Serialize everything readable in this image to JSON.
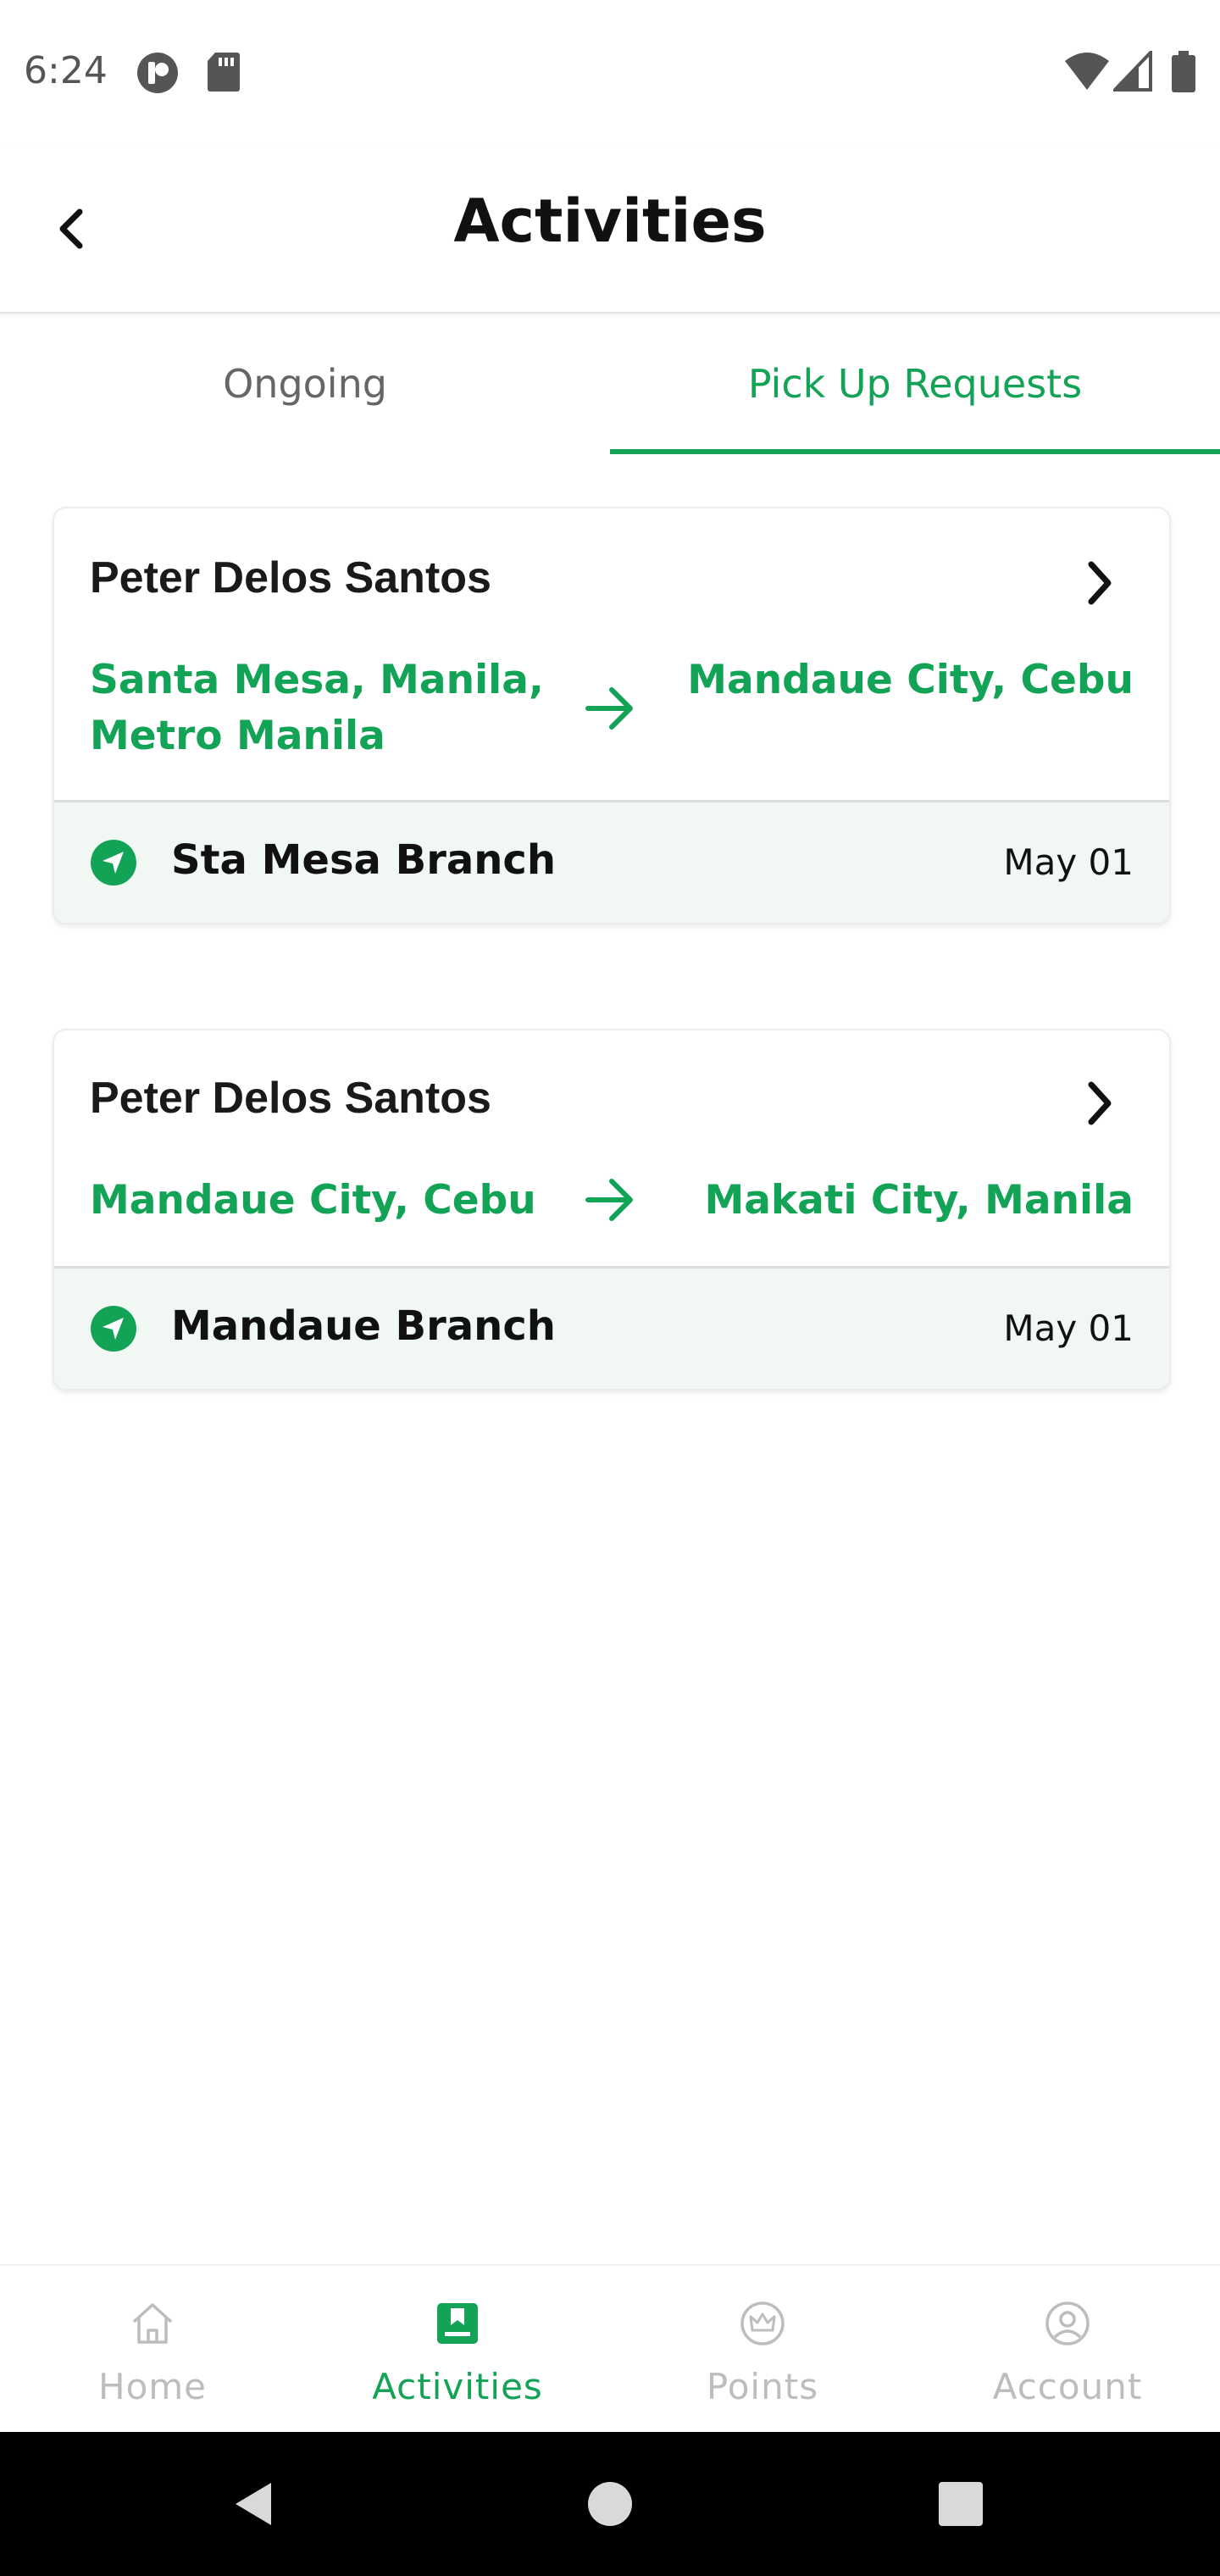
{
  "status_bar": {
    "time": "6:24",
    "icons": [
      "privacy-indicator-icon",
      "sd-card-icon",
      "wifi-icon",
      "cellular-signal-icon",
      "battery-icon"
    ]
  },
  "header": {
    "title": "Activities",
    "back_icon": "chevron-left-icon"
  },
  "tabs": [
    {
      "label": "Ongoing",
      "active": false
    },
    {
      "label": "Pick Up Requests",
      "active": true
    }
  ],
  "requests": [
    {
      "name": "Peter Delos Santos",
      "from_line1": "Santa Mesa, Manila,",
      "from_line2": "Metro Manila",
      "to": "Mandaue City, Cebu",
      "branch": "Sta Mesa Branch",
      "date": "May 01"
    },
    {
      "name": "Peter Delos Santos",
      "from_line1": "Mandaue City, Cebu",
      "from_line2": "",
      "to": "Makati City, Manila",
      "branch": "Mandaue Branch",
      "date": "May 01"
    }
  ],
  "bottom_nav": [
    {
      "label": "Home",
      "icon": "home-icon",
      "active": false
    },
    {
      "label": "Activities",
      "icon": "activities-icon",
      "active": true
    },
    {
      "label": "Points",
      "icon": "crown-icon",
      "active": false
    },
    {
      "label": "Account",
      "icon": "account-icon",
      "active": false
    }
  ],
  "colors": {
    "accent": "#13a356",
    "footer_bg": "#f1f8f3",
    "inactive": "#bdbdbd"
  }
}
